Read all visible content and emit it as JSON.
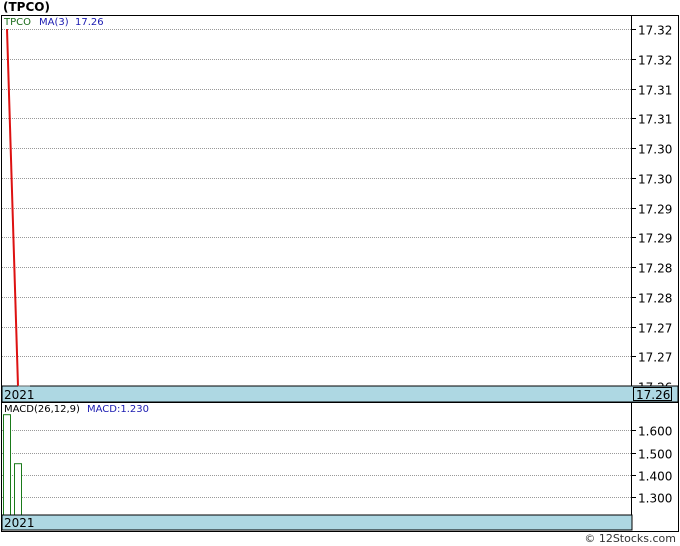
{
  "ticker": "(TPCO)",
  "watermark": "© 12Stocks.com",
  "colors": {
    "price_line": "#dd1111",
    "macd_bar": "#1a7a1a",
    "grid": "#999999",
    "date_bar": "#aed8e3",
    "legend_ticker": "#1a6b1a",
    "legend_ma": "#1a1ab0"
  },
  "price_panel": {
    "legend_ticker": "TPCO",
    "legend_ma": "MA(3)",
    "legend_value": "17.26",
    "year_label": "2021",
    "last_price_label": "17.26"
  },
  "macd_panel": {
    "legend_params": "MACD(26,12,9)",
    "legend_value": "MACD:1.230",
    "year_label": "2021"
  },
  "chart_data": [
    {
      "type": "line",
      "title": "(TPCO)",
      "series": [
        {
          "name": "TPCO",
          "x": [
            1,
            2
          ],
          "values": [
            17.32,
            17.26
          ]
        }
      ],
      "ylim": [
        17.26,
        17.325
      ],
      "yticks": [
        "17.32",
        "17.32",
        "17.31",
        "17.31",
        "17.30",
        "17.30",
        "17.29",
        "17.29",
        "17.28",
        "17.28",
        "17.27",
        "17.27",
        "17.26"
      ],
      "xlabel": "2021",
      "grid": true
    },
    {
      "type": "bar",
      "title": "MACD(26,12,9)",
      "series": [
        {
          "name": "MACD",
          "values": [
            1.67,
            1.45
          ]
        }
      ],
      "ylim": [
        1.22,
        1.7
      ],
      "yticks": [
        "1.600",
        "1.500",
        "1.400",
        "1.300"
      ],
      "ytick_values": [
        1.6,
        1.5,
        1.4,
        1.3
      ],
      "xlabel": "2021",
      "grid": true
    }
  ]
}
